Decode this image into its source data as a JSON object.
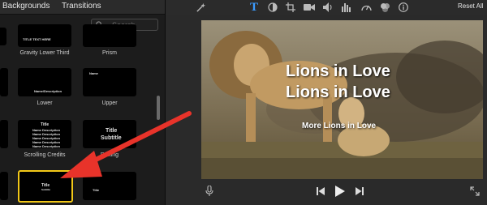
{
  "browser": {
    "tabs": [
      "Backgrounds",
      "Transitions"
    ],
    "search_placeholder": "Search",
    "titles": [
      {
        "label": "Gravity Lower Third",
        "inner": "TITLE TEXT HERE"
      },
      {
        "label": "Prism",
        "inner": ""
      },
      {
        "label": "Lower",
        "inner": "Name/Description"
      },
      {
        "label": "Upper",
        "inner": "Name"
      },
      {
        "label": "Scrolling Credits",
        "inner_title": "Title",
        "inner_rows": [
          "Name    Description",
          "Name    Description",
          "Name    Description",
          "Name    Description",
          "Name    Description"
        ]
      },
      {
        "label": "Drifting",
        "inner_title": "Title",
        "inner_sub": "Subtitle"
      },
      {
        "label": "",
        "inner_title": "Title",
        "inner_sub": "Subtitle",
        "selected": true
      },
      {
        "label": "",
        "inner": "Title"
      }
    ]
  },
  "toolbar": {
    "icons": [
      "magic-wand",
      "text",
      "color-balance",
      "crop",
      "camera",
      "volume",
      "equalizer",
      "speed",
      "filter",
      "info"
    ],
    "reset_label": "Reset All",
    "accent_color": "#3b9cff"
  },
  "viewer": {
    "title_line_1": "Lions in Love",
    "title_line_2": "Lions in Love",
    "subtitle": "More Lions in Love"
  },
  "annotation": {
    "color": "#e8332a"
  }
}
